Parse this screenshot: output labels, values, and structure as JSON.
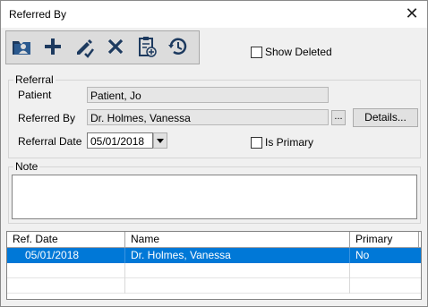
{
  "window": {
    "title": "Referred By",
    "close_glyph": "✕"
  },
  "toolbar": {
    "buttons": [
      {
        "name": "select-patient-button",
        "icon": "patient-folder-icon"
      },
      {
        "name": "add-button",
        "icon": "plus-icon"
      },
      {
        "name": "edit-button",
        "icon": "pencil-edit-icon"
      },
      {
        "name": "delete-button",
        "icon": "x-delete-icon"
      },
      {
        "name": "clipboard-button",
        "icon": "clipboard-icon"
      },
      {
        "name": "history-button",
        "icon": "clock-history-icon"
      }
    ],
    "show_deleted_label": "Show Deleted",
    "show_deleted_checked": false
  },
  "referral": {
    "legend": "Referral",
    "patient_label": "Patient",
    "patient_value": "Patient, Jo",
    "referred_by_label": "Referred By",
    "referred_by_value": "Dr. Holmes, Vanessa",
    "browse_label": "...",
    "details_label": "Details...",
    "referral_date_label": "Referral Date",
    "referral_date_value": "05/01/2018",
    "is_primary_label": "Is Primary",
    "is_primary_checked": false
  },
  "note": {
    "legend": "Note",
    "value": ""
  },
  "grid": {
    "columns": [
      "Ref. Date",
      "Name",
      "Primary"
    ],
    "rows": [
      {
        "date": "05/01/2018",
        "name": "Dr. Holmes, Vanessa",
        "primary": "No",
        "selected": true
      }
    ]
  },
  "colors": {
    "selection": "#0078d7",
    "toolbar_bg": "#dcdcdc"
  }
}
